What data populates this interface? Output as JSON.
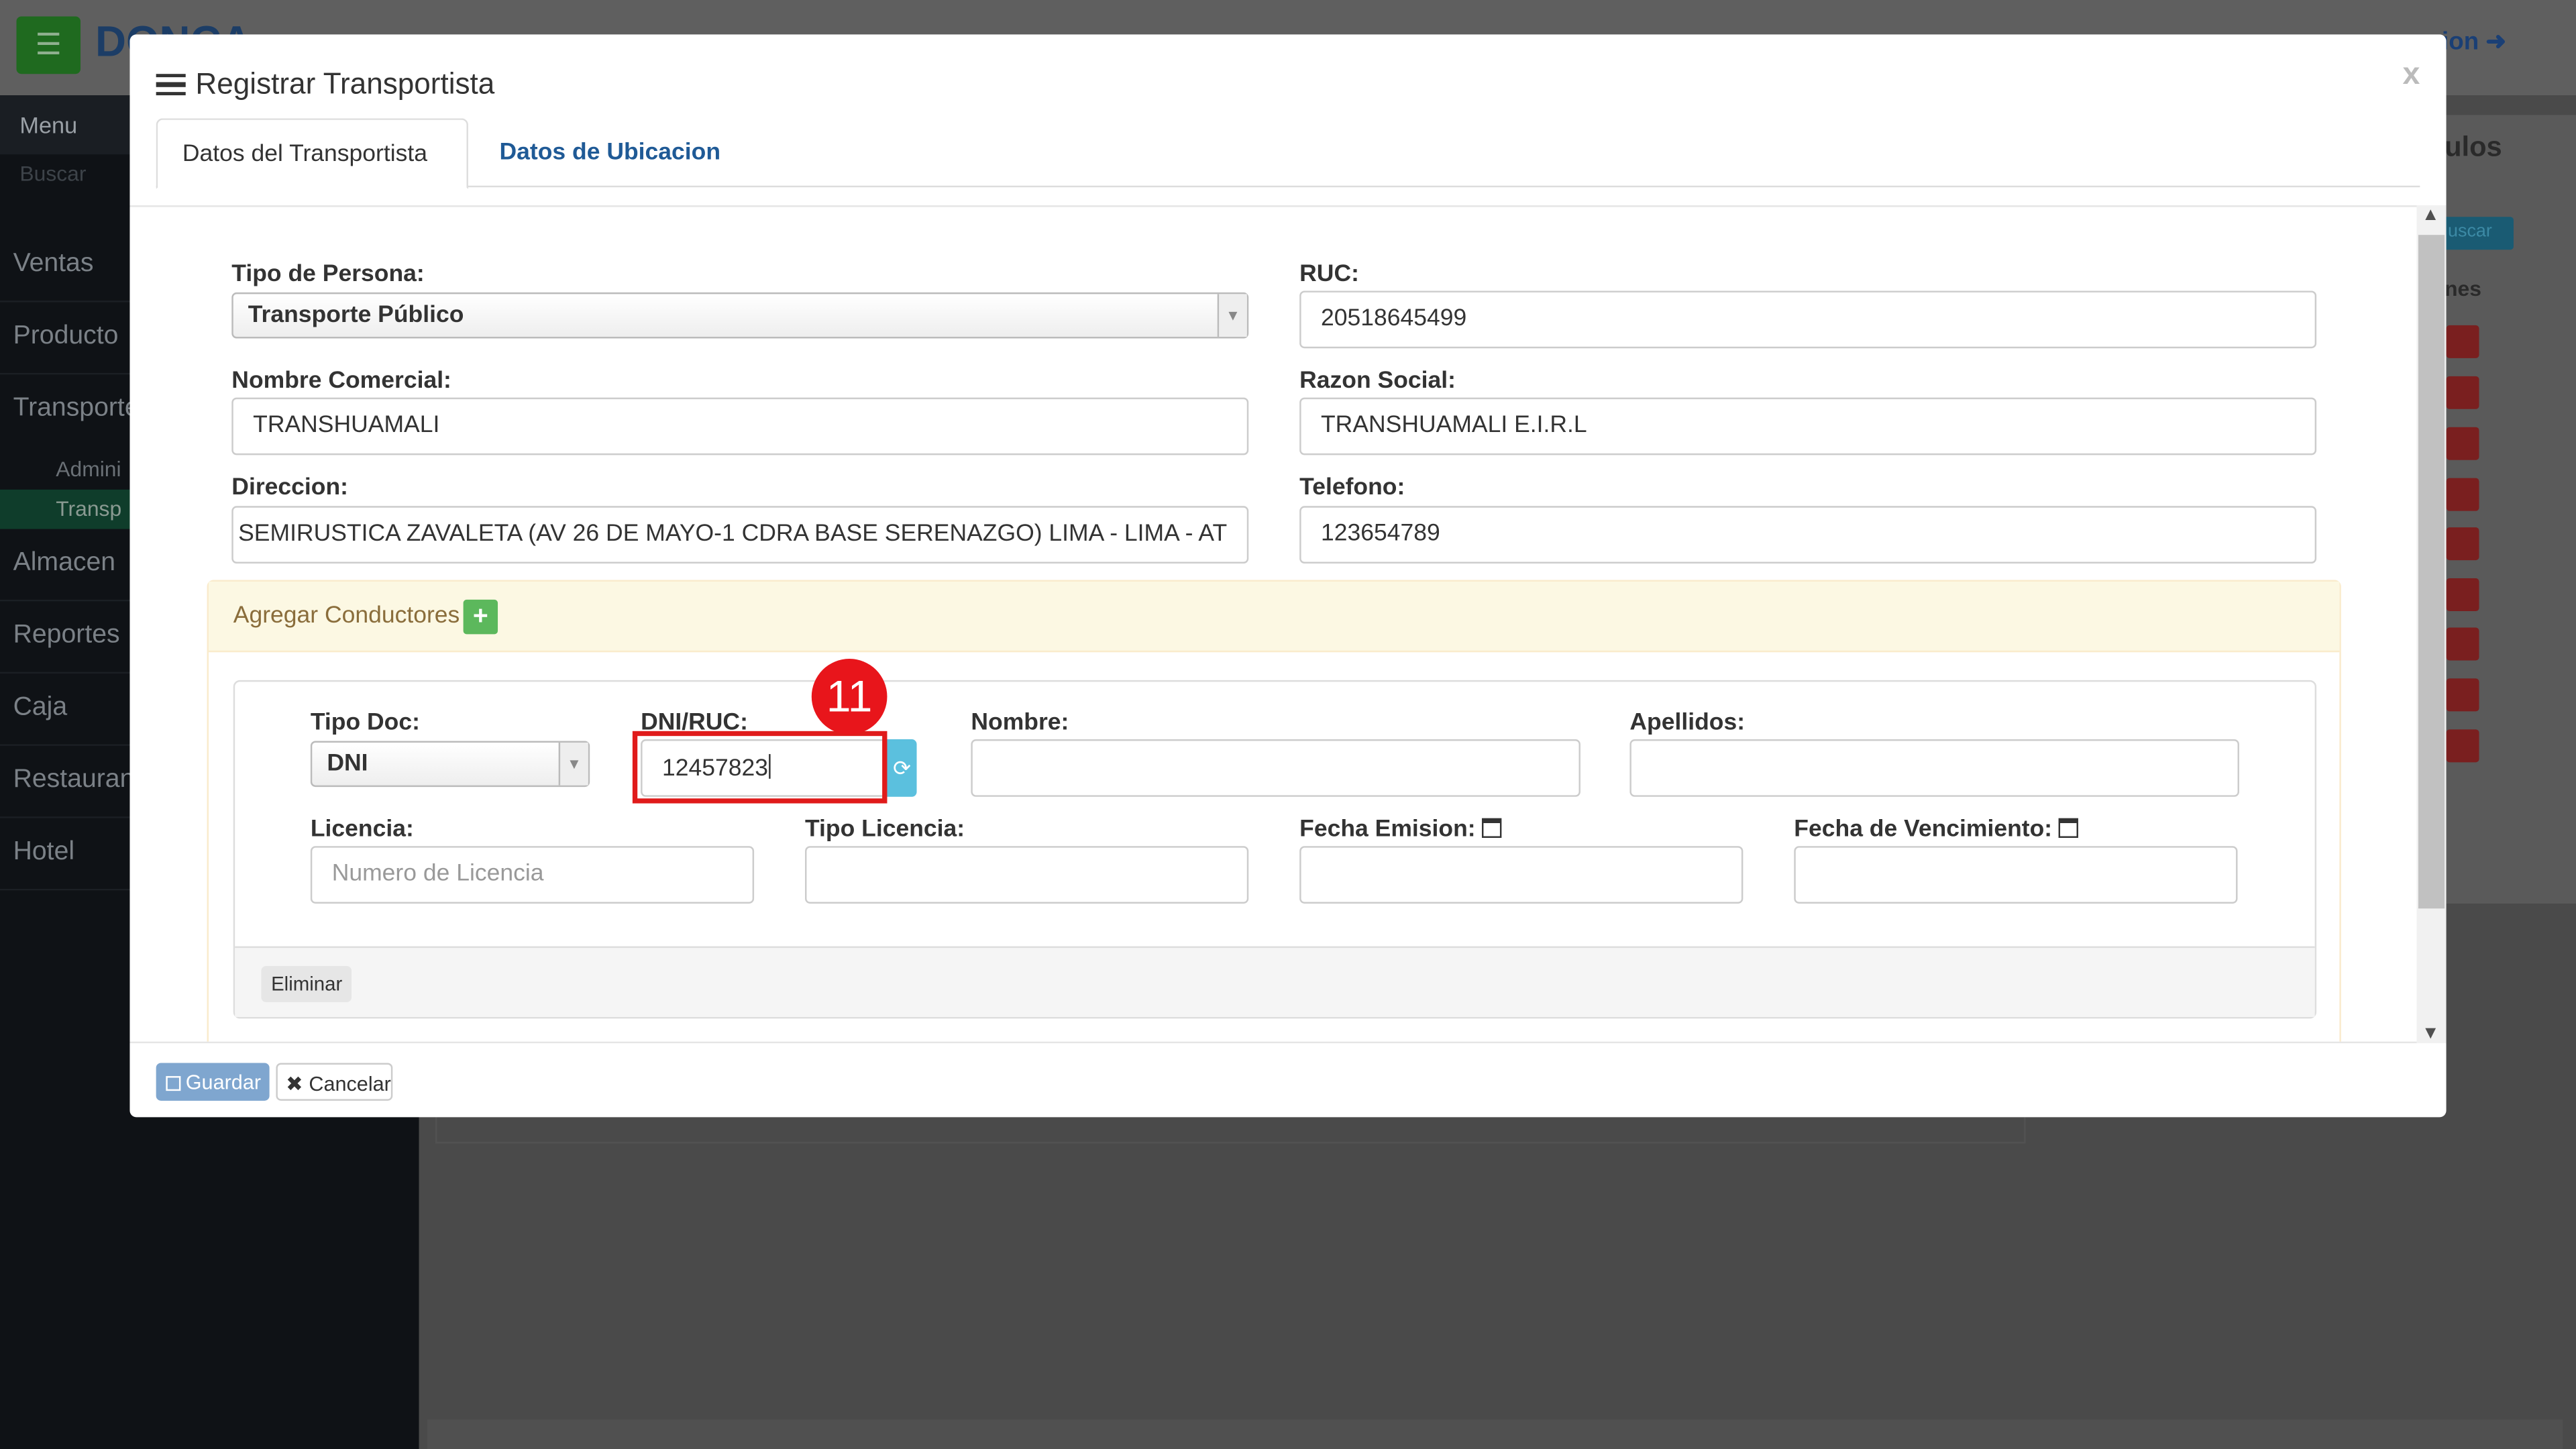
{
  "background": {
    "brand": "DONCA",
    "session_label": "sion",
    "menu_header": "Menu",
    "search_placeholder": "Buscar",
    "sidebar_items": [
      "Ventas",
      "Producto",
      "Transporte",
      "Almacen",
      "Reportes",
      "Caja",
      "Restaurant",
      "Hotel"
    ],
    "sidebar_subitems": [
      "Admini",
      "Transp"
    ],
    "panel_title": "ulos",
    "search_button": "uscar",
    "column_header": "nes"
  },
  "modal": {
    "title": "Registrar Transportista",
    "close": "x",
    "tabs": [
      "Datos del Transportista",
      "Datos de Ubicacion"
    ],
    "form": {
      "tipo_persona_label": "Tipo de Persona:",
      "tipo_persona_value": "Transporte Público",
      "ruc_label": "RUC:",
      "ruc_value": "20518645499",
      "nombre_comercial_label": "Nombre Comercial:",
      "nombre_comercial_value": "TRANSHUAMALI",
      "razon_social_label": "Razon Social:",
      "razon_social_value": "TRANSHUAMALI E.I.R.L",
      "direccion_label": "Direccion:",
      "direccion_value": "SEMIRUSTICA ZAVALETA (AV 26 DE MAYO-1 CDRA BASE SERENAZGO) LIMA - LIMA - AT",
      "telefono_label": "Telefono:",
      "telefono_value": "123654789"
    },
    "conductores": {
      "header": "Agregar Conductores",
      "tipo_doc_label": "Tipo Doc:",
      "tipo_doc_value": "DNI",
      "dni_ruc_label": "DNI/RUC:",
      "dni_ruc_value": "12457823",
      "nombre_label": "Nombre:",
      "apellidos_label": "Apellidos:",
      "licencia_label": "Licencia:",
      "licencia_placeholder": "Numero de Licencia",
      "tipo_licencia_label": "Tipo Licencia:",
      "fecha_emision_label": "Fecha Emision:",
      "fecha_vencimiento_label": "Fecha de Vencimiento:",
      "eliminar": "Eliminar"
    },
    "footer": {
      "save": "Guardar",
      "cancel": "Cancelar"
    }
  },
  "annotation": {
    "step_number": "11",
    "color": "#e8151b"
  }
}
